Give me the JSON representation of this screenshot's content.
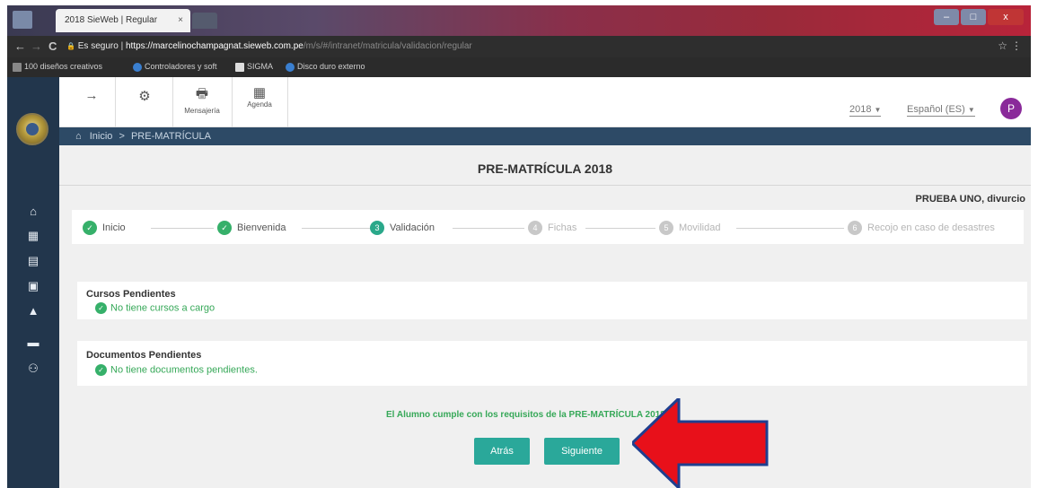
{
  "browser": {
    "tab_title": "2018 SieWeb | Regular",
    "tab_close": "×",
    "url_secure": "Es seguro",
    "url_sep": "|",
    "url_host": "https://marcelinochampagnat.sieweb.com.pe",
    "url_path": "/m/s/#/intranet/matricula/validacion/regular",
    "window_buttons": {
      "minimize": "–",
      "maximize": "□",
      "close": "x"
    },
    "nav": {
      "back": "←",
      "forward": "→",
      "reload": "C",
      "lock": "🔒",
      "star": "☆",
      "menu": "⋮"
    }
  },
  "bookmarks": [
    {
      "label": "100 diseños creativos",
      "color": "#888888"
    },
    {
      "label": "Controladores y soft",
      "color": "#3a7fd0"
    },
    {
      "label": "SIGMA",
      "color": "#dddddd"
    },
    {
      "label": "Disco duro externo",
      "color": "#3a7fd0"
    }
  ],
  "toolbar": {
    "forward_glyph": "→",
    "tools_glyph": "⚙",
    "mensajeria": {
      "glyph": "🖶",
      "label": "Mensajería"
    },
    "agenda": {
      "glyph": "▦",
      "label": "Agenda"
    },
    "year": "2018",
    "year_caret": "▼",
    "language": "Español (ES)",
    "language_caret": "▼",
    "avatar_letter": "P"
  },
  "breadcrumb": {
    "home_glyph": "⌂",
    "items": [
      "Inicio",
      ">",
      "PRE-MATRÍCULA"
    ]
  },
  "sidebar_icons": [
    {
      "name": "home-icon",
      "glyph": "⌂"
    },
    {
      "name": "calendar-icon",
      "glyph": "▦"
    },
    {
      "name": "print-icon",
      "glyph": "▤"
    },
    {
      "name": "card-icon",
      "glyph": "▣"
    },
    {
      "name": "user-icon",
      "glyph": "▲"
    },
    {
      "name": "book-icon",
      "glyph": "▬"
    },
    {
      "name": "people-icon",
      "glyph": "⚇"
    }
  ],
  "page": {
    "title": "PRE-MATRÍCULA 2018",
    "student": "PRUEBA UNO, divurcio"
  },
  "stepper": [
    {
      "label": "Inicio",
      "state": "done",
      "marker": "✓"
    },
    {
      "label": "Bienvenida",
      "state": "done",
      "marker": "✓"
    },
    {
      "label": "Validación",
      "state": "active",
      "marker": "3"
    },
    {
      "label": "Fichas",
      "state": "todo",
      "marker": "4"
    },
    {
      "label": "Movilidad",
      "state": "todo",
      "marker": "5"
    },
    {
      "label": "Recojo en caso de desastres",
      "state": "todo",
      "marker": "6"
    }
  ],
  "panels": {
    "cursos": {
      "title": "Cursos Pendientes",
      "item": "No tiene cursos a cargo",
      "check": "✓"
    },
    "documentos": {
      "title": "Documentos Pendientes",
      "item": "No tiene documentos pendientes.",
      "check": "✓"
    }
  },
  "requirement_message": "El Alumno cumple con los requisitos de la PRE-MATRÍCULA 2018",
  "buttons": {
    "back": "Atrás",
    "next": "Siguiente"
  },
  "colors": {
    "sidebar": "#22364c",
    "breadcrumb_bar": "#2d4a66",
    "success": "#36b06a",
    "button": "#2aa89a",
    "arrow": "#e8101a"
  }
}
